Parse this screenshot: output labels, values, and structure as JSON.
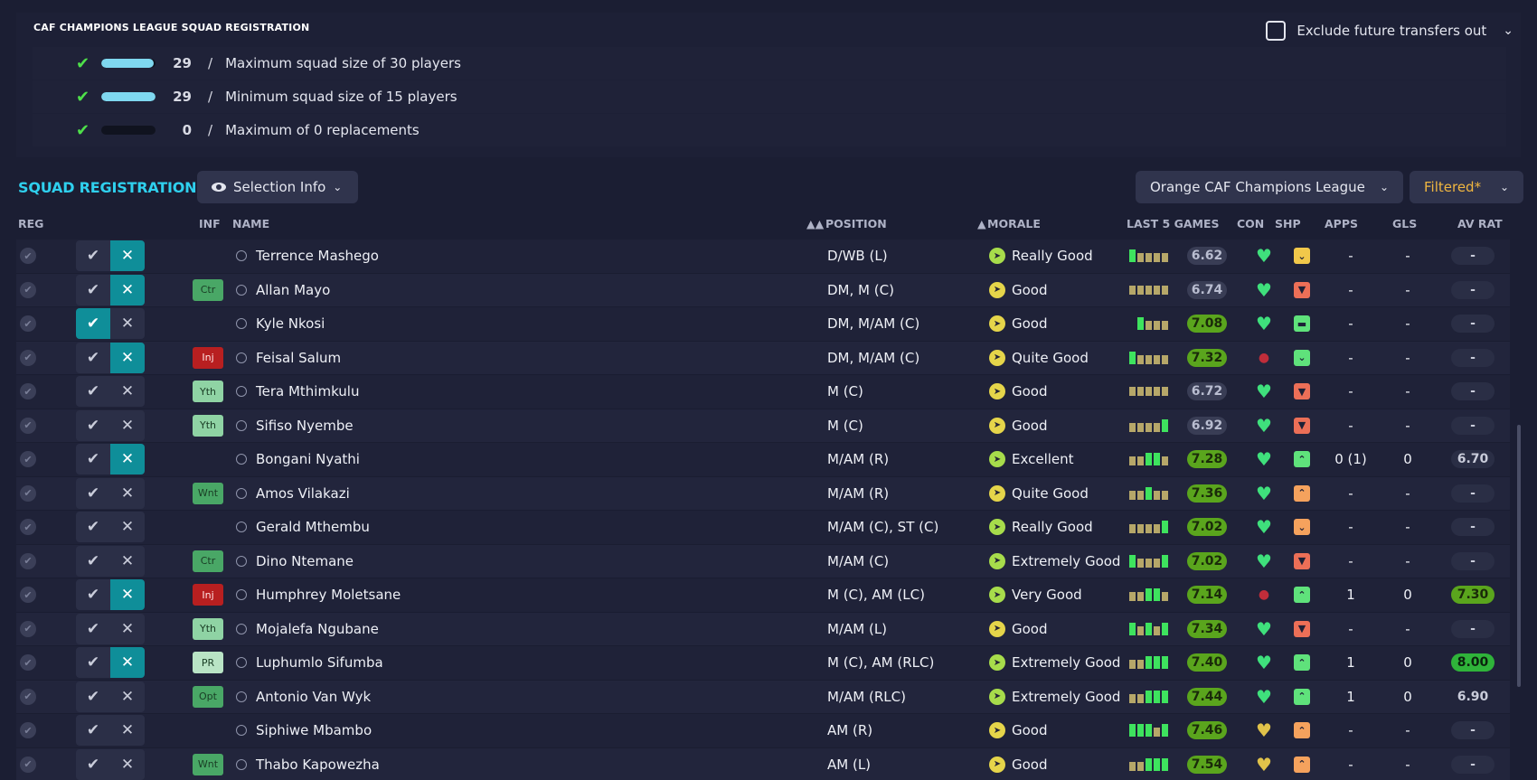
{
  "rules": {
    "title": "CAF CHAMPIONS LEAGUE SQUAD REGISTRATION",
    "exclude_label": "Exclude future transfers out",
    "items": [
      {
        "count": "29",
        "text": "Maximum squad size of 30 players",
        "fill": 0.97
      },
      {
        "count": "29",
        "text": "Minimum squad size of 15 players",
        "fill": 1.0
      },
      {
        "count": "0",
        "text": "Maximum of 0 replacements",
        "fill": 0.0
      }
    ]
  },
  "header": {
    "title": "SQUAD REGISTRATION",
    "selection_info": "Selection Info",
    "league": "Orange CAF Champions League",
    "filter": "Filtered*"
  },
  "columns": {
    "reg": "REG",
    "inf": "INF",
    "name": "NAME",
    "position": "POSITION",
    "morale": "MORALE",
    "last5": "LAST 5 GAMES",
    "con": "CON",
    "shp": "SHP",
    "apps": "APPS",
    "gls": "GLS",
    "avrat": "AV RAT"
  },
  "players": [
    {
      "name": "Terrence Mashego",
      "inf": "",
      "position": "D/WB (L)",
      "morale": "Really Good",
      "last": "6.62",
      "apps": "-",
      "gls": "-",
      "avrat": "-"
    },
    {
      "name": "Allan Mayo",
      "inf": "Ctr",
      "position": "DM, M (C)",
      "morale": "Good",
      "last": "6.74",
      "apps": "-",
      "gls": "-",
      "avrat": "-"
    },
    {
      "name": "Kyle Nkosi",
      "inf": "",
      "position": "DM, M/AM (C)",
      "morale": "Good",
      "last": "7.08",
      "apps": "-",
      "gls": "-",
      "avrat": "-"
    },
    {
      "name": "Feisal Salum",
      "inf": "Inj",
      "position": "DM, M/AM (C)",
      "morale": "Quite Good",
      "last": "7.32",
      "apps": "-",
      "gls": "-",
      "avrat": "-"
    },
    {
      "name": "Tera Mthimkulu",
      "inf": "Yth",
      "position": "M (C)",
      "morale": "Good",
      "last": "6.72",
      "apps": "-",
      "gls": "-",
      "avrat": "-"
    },
    {
      "name": "Sifiso Nyembe",
      "inf": "Yth",
      "position": "M (C)",
      "morale": "Good",
      "last": "6.92",
      "apps": "-",
      "gls": "-",
      "avrat": "-"
    },
    {
      "name": "Bongani Nyathi",
      "inf": "",
      "position": "M/AM (R)",
      "morale": "Excellent",
      "last": "7.28",
      "apps": "0 (1)",
      "gls": "0",
      "avrat": "6.70"
    },
    {
      "name": "Amos Vilakazi",
      "inf": "Wnt",
      "position": "M/AM (R)",
      "morale": "Quite Good",
      "last": "7.36",
      "apps": "-",
      "gls": "-",
      "avrat": "-"
    },
    {
      "name": "Gerald Mthembu",
      "inf": "",
      "position": "M/AM (C), ST (C)",
      "morale": "Really Good",
      "last": "7.02",
      "apps": "-",
      "gls": "-",
      "avrat": "-"
    },
    {
      "name": "Dino Ntemane",
      "inf": "Ctr",
      "position": "M/AM (C)",
      "morale": "Extremely Good",
      "last": "7.02",
      "apps": "-",
      "gls": "-",
      "avrat": "-"
    },
    {
      "name": "Humphrey Moletsane",
      "inf": "Inj",
      "position": "M (C), AM (LC)",
      "morale": "Very Good",
      "last": "7.14",
      "apps": "1",
      "gls": "0",
      "avrat": "7.30"
    },
    {
      "name": "Mojalefa Ngubane",
      "inf": "Yth",
      "position": "M/AM (L)",
      "morale": "Good",
      "last": "7.34",
      "apps": "-",
      "gls": "-",
      "avrat": "-"
    },
    {
      "name": "Luphumlo Sifumba",
      "inf": "PR",
      "position": "M (C), AM (RLC)",
      "morale": "Extremely Good",
      "last": "7.40",
      "apps": "1",
      "gls": "0",
      "avrat": "8.00"
    },
    {
      "name": "Antonio Van Wyk",
      "inf": "Opt",
      "position": "M/AM (RLC)",
      "morale": "Extremely Good",
      "last": "7.44",
      "apps": "1",
      "gls": "0",
      "avrat": "6.90"
    },
    {
      "name": "Siphiwe Mbambo",
      "inf": "",
      "position": "AM (R)",
      "morale": "Good",
      "last": "7.46",
      "apps": "-",
      "gls": "-",
      "avrat": "-"
    },
    {
      "name": "Thabo Kapowezha",
      "inf": "Wnt",
      "position": "AM (L)",
      "morale": "Good",
      "last": "7.54",
      "apps": "-",
      "gls": "-",
      "avrat": "-"
    }
  ]
}
